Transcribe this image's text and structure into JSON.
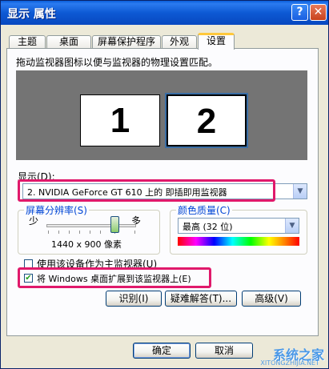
{
  "window": {
    "title": "显示 属性",
    "help_label": "?",
    "close_label": "✕"
  },
  "tabs": [
    {
      "label": "主题"
    },
    {
      "label": "桌面"
    },
    {
      "label": "屏幕保护程序"
    },
    {
      "label": "外观"
    },
    {
      "label": "设置",
      "active": true
    }
  ],
  "instruction": "拖动监视器图标以便与监视器的物理设置匹配。",
  "monitors": [
    {
      "label": "1"
    },
    {
      "label": "2",
      "selected": true
    }
  ],
  "display": {
    "label": "显示(D):",
    "value": "2. NVIDIA GeForce GT 610 上的 即插即用监视器"
  },
  "resolution": {
    "title": "屏幕分辨率(S)",
    "less_label": "少",
    "more_label": "多",
    "value": "1440 x 900 像素",
    "level_fraction": 0.85
  },
  "color_quality": {
    "title": "颜色质量(C)",
    "value": "最高 (32 位)"
  },
  "options": {
    "primary_label": "使用该设备作为主监视器(U)",
    "primary_checked": false,
    "extend_label": "将 Windows 桌面扩展到该监视器上(E)",
    "extend_checked": true
  },
  "buttons": {
    "identify": "识别(I)",
    "troubleshoot": "疑难解答(T)...",
    "advanced": "高级(V)",
    "ok": "确定",
    "cancel": "取消"
  },
  "watermark": {
    "text": "系统之家",
    "sub": "XITONGZHIJIA.NET"
  },
  "colors": {
    "highlight": "#E0196B",
    "titlebar": "#0A5FDC",
    "group_title": "#0046D5"
  }
}
